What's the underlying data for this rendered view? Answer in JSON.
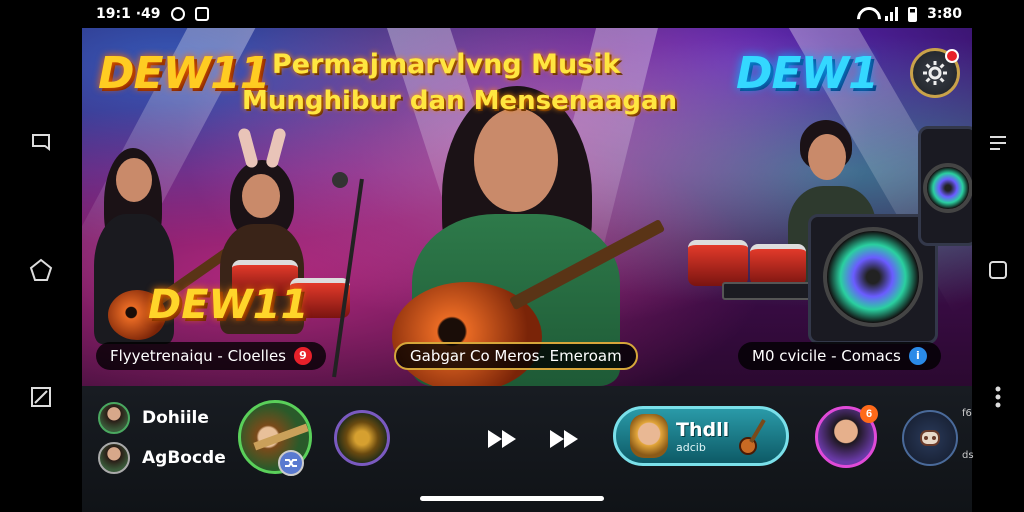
{
  "status_bar": {
    "time_left": "19:1 ·49",
    "time_right": "3:80",
    "icons": [
      "notification-icon",
      "gallery-icon",
      "wifi-icon",
      "signal-icon",
      "battery-icon"
    ]
  },
  "banner": {
    "brand_left": "DEW11",
    "brand_right": "DEW1",
    "brand_mid": "DEW11",
    "title_line1": "Permajmarvlvng Musik",
    "title_line2": "Munghibur dan Mensenaagan",
    "settings_notification": "!",
    "captions": [
      {
        "text": "Flyyetrenaiqu - Cloelles",
        "badge": "9",
        "badge_color": "#e8202a"
      },
      {
        "text": "Gabgar  Co  Meros- Emeroam",
        "badge": "",
        "badge_color": ""
      },
      {
        "text": "M0 cvicile - Comacs",
        "badge": "i",
        "badge_color": "#2a8ae8"
      }
    ]
  },
  "friends": [
    {
      "name": "Dohiile"
    },
    {
      "name": "AgBocde"
    }
  ],
  "player": {
    "now_playing_title": "Thdll",
    "now_playing_sub": "adcib",
    "profile_badge": "6"
  },
  "edge_labels": {
    "top": "f6",
    "bottom": "ds"
  },
  "colors": {
    "brand_gold": "#ffcc22",
    "brand_cyan": "#34d8ff",
    "play_pill": "#2a9aa8",
    "accent_green": "#5ad05a"
  }
}
